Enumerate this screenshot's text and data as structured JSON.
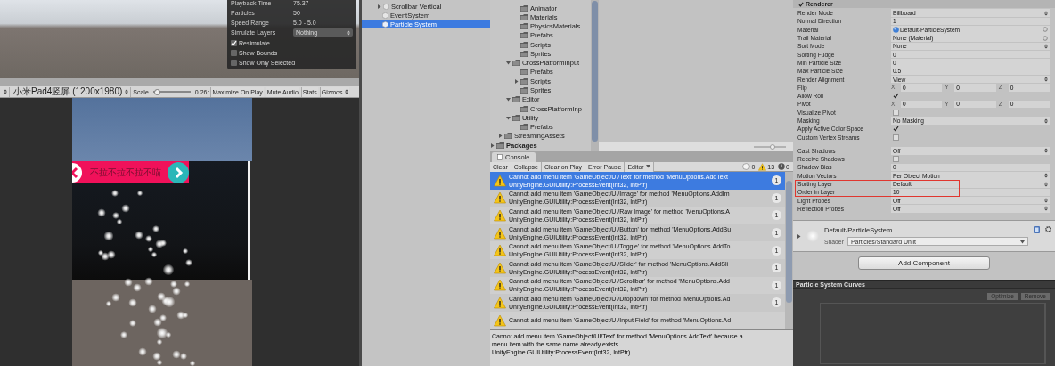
{
  "particle_effect": {
    "rows": [
      {
        "label": "Playback Time",
        "value": "75.37"
      },
      {
        "label": "Particles",
        "value": "50"
      },
      {
        "label": "Speed Range",
        "value": "5.0 - 5.0"
      }
    ],
    "simulate_layers": {
      "label": "Simulate Layers",
      "value": "Nothing"
    },
    "toggles": [
      {
        "label": "Resimulate",
        "checked": true
      },
      {
        "label": "Show Bounds",
        "checked": false
      },
      {
        "label": "Show Only Selected",
        "checked": false
      }
    ]
  },
  "game_toolbar": {
    "resolution": "小米Pad4竖屏 (1200x1980)",
    "scale_label": "Scale",
    "scale": {
      "level": 0.02
    },
    "scale_value": "0.26:",
    "buttons": [
      {
        "label": "Maximize On Play",
        "kind": "toggle"
      },
      {
        "label": "Mute Audio",
        "kind": "toggle"
      },
      {
        "label": "Stats",
        "kind": "toggle"
      },
      {
        "label": "Gizmos",
        "kind": "menu"
      }
    ]
  },
  "game_view": {
    "banner_text": "不拉不拉不拉不喵"
  },
  "hierarchy": {
    "items": [
      {
        "label": "Scrollbar Vertical",
        "selected": false,
        "expanded": false
      },
      {
        "label": "EventSystem",
        "selected": false
      },
      {
        "label": "Particle System",
        "selected": true
      }
    ]
  },
  "project": {
    "zoom": {
      "level": 0.6
    },
    "tree": [
      {
        "children": [
          {
            "children": [
              {
                "children": [
                  {
                    "label": "Animator"
                  },
                  {
                    "label": "Materials"
                  },
                  {
                    "label": "PhysicsMaterials"
                  },
                  {
                    "label": "Prefabs"
                  },
                  {
                    "label": "Scripts"
                  },
                  {
                    "label": "Sprites"
                  }
                ]
              },
              {
                "label": "CrossPlatformInput",
                "expanded": true,
                "children": [
                  {
                    "label": "Prefabs"
                  },
                  {
                    "label": "Scripts",
                    "expanded": false
                  },
                  {
                    "label": "Sprites"
                  }
                ]
              },
              {
                "label": "Editor",
                "expanded": true,
                "children": [
                  {
                    "label": "CrossPlatformInp"
                  }
                ]
              },
              {
                "label": "Utility",
                "expanded": true,
                "children": [
                  {
                    "label": "Prefabs"
                  }
                ]
              }
            ]
          },
          {
            "label": "StreamingAssets",
            "expanded": false
          }
        ]
      },
      {
        "label": "Packages",
        "expanded": false
      }
    ]
  },
  "console": {
    "tab": "Console",
    "buttons": [
      {
        "label": "Clear",
        "kind": "button"
      },
      {
        "label": "Collapse",
        "kind": "button"
      },
      {
        "label": "Clear on Play",
        "kind": "button"
      },
      {
        "label": "Error Pause",
        "kind": "button"
      },
      {
        "label": "Editor",
        "kind": "menu"
      }
    ],
    "counts": [
      {
        "kind": "info",
        "value": "0"
      },
      {
        "kind": "warning",
        "value": "13"
      },
      {
        "kind": "error",
        "value": "0"
      }
    ],
    "messages": [
      {
        "text": "Cannot add menu item 'GameObject/UI/Text' for method 'MenuOptions.AddText",
        "trace": "UnityEngine.GUIUtility:ProcessEvent(Int32, IntPtr)",
        "count": "1",
        "selected": true
      },
      {
        "text": "Cannot add menu item 'GameObject/UI/Image' for method 'MenuOptions.AddIm",
        "trace": "UnityEngine.GUIUtility:ProcessEvent(Int32, IntPtr)",
        "count": "1",
        "selected": false
      },
      {
        "text": "Cannot add menu item 'GameObject/UI/Raw Image' for method 'MenuOptions.A",
        "trace": "UnityEngine.GUIUtility:ProcessEvent(Int32, IntPtr)",
        "count": "1",
        "selected": false
      },
      {
        "text": "Cannot add menu item 'GameObject/UI/Button' for method 'MenuOptions.AddBu",
        "trace": "UnityEngine.GUIUtility:ProcessEvent(Int32, IntPtr)",
        "count": "1",
        "selected": false
      },
      {
        "text": "Cannot add menu item 'GameObject/UI/Toggle' for method 'MenuOptions.AddTo",
        "trace": "UnityEngine.GUIUtility:ProcessEvent(Int32, IntPtr)",
        "count": "1",
        "selected": false
      },
      {
        "text": "Cannot add menu item 'GameObject/UI/Slider' for method 'MenuOptions.AddSli",
        "trace": "UnityEngine.GUIUtility:ProcessEvent(Int32, IntPtr)",
        "count": "1",
        "selected": false
      },
      {
        "text": "Cannot add menu item 'GameObject/UI/Scrollbar' for method 'MenuOptions.Add",
        "trace": "UnityEngine.GUIUtility:ProcessEvent(Int32, IntPtr)",
        "count": "1",
        "selected": false
      },
      {
        "text": "Cannot add menu item 'GameObject/UI/Dropdown' for method 'MenuOptions.Ad",
        "trace": "UnityEngine.GUIUtility:ProcessEvent(Int32, IntPtr)",
        "count": "1",
        "selected": false
      },
      {
        "text": "Cannot add menu item 'GameObject/UI/Input Field' for method 'MenuOptions.Ad",
        "selected": false
      }
    ],
    "detail": [
      "Cannot add menu item 'GameObject/UI/Text' for method 'MenuOptions.AddText' because a",
      "menu item with the same name already exists.",
      "UnityEngine.GUIUtility:ProcessEvent(Int32, IntPtr)"
    ]
  },
  "inspector": {
    "renderer": {
      "label": "Renderer",
      "checked": true,
      "groups": [
        {
          "rows": [
            {
              "label": "Render Mode",
              "kind": "dropdown",
              "value": "Billboard",
              "highlighted": false
            },
            {
              "label": "Normal Direction",
              "kind": "text",
              "value": "1",
              "highlighted": false
            },
            {
              "label": "Material",
              "kind": "object",
              "value": "Default-ParticleSystem",
              "has_icon": true,
              "highlighted": false
            },
            {
              "label": "Trail Material",
              "kind": "object",
              "value": "None (Material)",
              "has_icon": false,
              "highlighted": false
            },
            {
              "label": "Sort Mode",
              "kind": "dropdown",
              "value": "None",
              "highlighted": false
            },
            {
              "label": "Sorting Fudge",
              "kind": "text",
              "value": "0",
              "highlighted": false
            },
            {
              "label": "Min Particle Size",
              "kind": "text",
              "value": "0",
              "highlighted": false
            },
            {
              "label": "Max Particle Size",
              "kind": "text",
              "value": "0.5",
              "highlighted": false
            },
            {
              "label": "Render Alignment",
              "kind": "dropdown",
              "value": "View",
              "highlighted": false
            },
            {
              "label": "Flip",
              "kind": "vector3",
              "axes": [
                {
                  "axis": "X",
                  "value": "0"
                },
                {
                  "axis": "Y",
                  "value": "0"
                },
                {
                  "axis": "Z",
                  "value": "0"
                }
              ],
              "highlighted": false
            },
            {
              "label": "Allow Roll",
              "kind": "checkbox",
              "checked": true,
              "highlighted": false
            },
            {
              "label": "Pivot",
              "kind": "vector3",
              "axes": [
                {
                  "axis": "X",
                  "value": "0"
                },
                {
                  "axis": "Y",
                  "value": "0"
                },
                {
                  "axis": "Z",
                  "value": "0"
                }
              ],
              "highlighted": false
            },
            {
              "label": "Visualize Pivot",
              "kind": "checkbox",
              "checked": false,
              "highlighted": false
            },
            {
              "label": "Masking",
              "kind": "dropdown",
              "value": "No Masking",
              "highlighted": false
            },
            {
              "label": "Apply Active Color Space",
              "kind": "checkbox",
              "checked": true,
              "highlighted": false
            },
            {
              "label": "Custom Vertex Streams",
              "kind": "checkbox",
              "checked": false,
              "highlighted": false
            }
          ]
        },
        {
          "rows": [
            {
              "label": "Cast Shadows",
              "kind": "dropdown",
              "value": "Off",
              "highlighted": false
            },
            {
              "label": "Receive Shadows",
              "kind": "checkbox",
              "checked": false,
              "highlighted": false
            },
            {
              "label": "Shadow Bias",
              "kind": "text",
              "value": "0",
              "highlighted": false
            },
            {
              "label": "Motion Vectors",
              "kind": "dropdown",
              "value": "Per Object Motion",
              "highlighted": false
            },
            {
              "label": "Sorting Layer",
              "kind": "dropdown",
              "value": "Default",
              "highlighted": true
            },
            {
              "label": "Order in Layer",
              "kind": "text",
              "value": "10",
              "highlighted": true
            },
            {
              "label": "Light Probes",
              "kind": "dropdown",
              "value": "Off",
              "highlighted": false
            },
            {
              "label": "Reflection Probes",
              "kind": "dropdown",
              "value": "Off",
              "highlighted": false
            }
          ]
        }
      ]
    },
    "material": {
      "name": "Default-ParticleSystem",
      "shader_label": "Shader",
      "shader": "Particles/Standard Unlit"
    },
    "add_component": "Add Component",
    "curves": {
      "title": "Particle System Curves",
      "buttons": [
        "Optimize",
        "Remove"
      ]
    }
  }
}
